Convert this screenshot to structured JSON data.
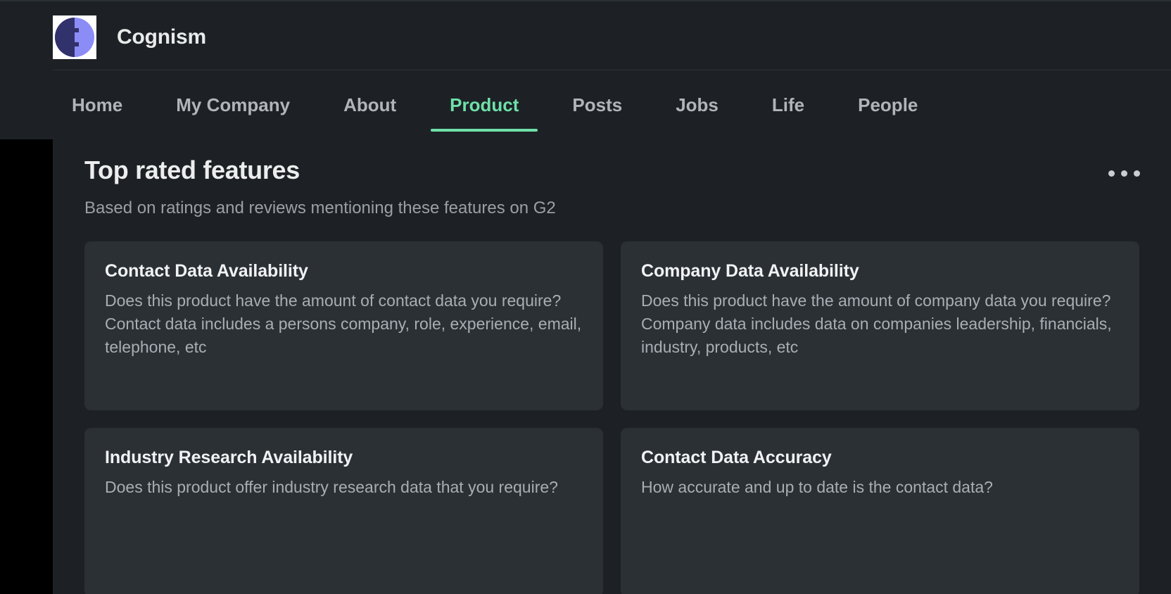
{
  "header": {
    "company_name": "Cognism",
    "logo_icon": "cognism-logo-icon",
    "nav": [
      {
        "label": "Home",
        "active": false
      },
      {
        "label": "My Company",
        "active": false
      },
      {
        "label": "About",
        "active": false
      },
      {
        "label": "Product",
        "active": true
      },
      {
        "label": "Posts",
        "active": false
      },
      {
        "label": "Jobs",
        "active": false
      },
      {
        "label": "Life",
        "active": false
      },
      {
        "label": "People",
        "active": false
      }
    ]
  },
  "main": {
    "title": "Top rated features",
    "subtitle": "Based on ratings and reviews mentioning these features on G2",
    "more_menu_icon": "ellipsis-icon",
    "cards": [
      {
        "title": "Contact Data Availability",
        "description": "Does this product have the amount of contact data you require? Contact data includes a persons company, role, experience, email, telephone, etc"
      },
      {
        "title": "Company Data Availability",
        "description": "Does this product have the amount of company data you require? Company data includes data on companies leadership, financials, industry, products, etc"
      },
      {
        "title": "Industry Research Availability",
        "description": "Does this product offer industry research data that you require?"
      },
      {
        "title": "Contact Data Accuracy",
        "description": "How accurate and up to date is the contact data?"
      }
    ]
  },
  "colors": {
    "page_background": "#000000",
    "panel_background": "#1d2125",
    "card_background": "#2b3035",
    "accent_green": "#6ee0a8",
    "text_primary": "#eceded",
    "text_secondary": "#9aa0a5",
    "logo_dark": "#31316b",
    "logo_light": "#8b8cf5"
  }
}
